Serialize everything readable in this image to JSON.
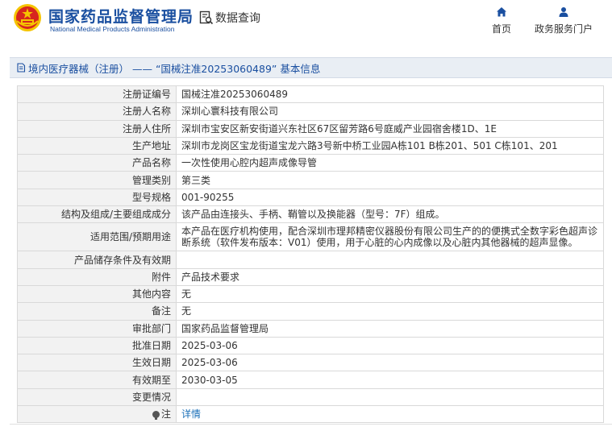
{
  "header": {
    "org_name_cn": "国家药品监督管理局",
    "org_name_en": "National Medical Products Administration",
    "query_label": "数据查询",
    "nav": [
      {
        "label": "首页",
        "icon": "home-icon"
      },
      {
        "label": "政务服务门户",
        "icon": "user-icon"
      }
    ]
  },
  "title_bar": {
    "text": "境内医疗器械（注册） —— “国械注准20253060489” 基本信息"
  },
  "colors": {
    "brand_blue": "#1a4fa0",
    "link_blue": "#1a6fb8",
    "emblem_red": "#d7261e",
    "emblem_gold": "#f5c400"
  },
  "info_rows": [
    {
      "label": "注册证编号",
      "value": "国械注准20253060489"
    },
    {
      "label": "注册人名称",
      "value": "深圳心寰科技有限公司"
    },
    {
      "label": "注册人住所",
      "value": "深圳市宝安区新安街道兴东社区67区留芳路6号庭威产业园宿舍楼1D、1E"
    },
    {
      "label": "生产地址",
      "value": "深圳市龙岗区宝龙街道宝龙六路3号新中桥工业园A栋101 B栋201、501 C栋101、201"
    },
    {
      "label": "产品名称",
      "value": "一次性使用心腔内超声成像导管"
    },
    {
      "label": "管理类别",
      "value": "第三类"
    },
    {
      "label": "型号规格",
      "value": "001-90255"
    },
    {
      "label": "结构及组成/主要组成成分",
      "value": "该产品由连接头、手柄、鞘管以及换能器（型号：7F）组成。"
    },
    {
      "label": "适用范围/预期用途",
      "value": "本产品在医疗机构使用，配合深圳市理邦精密仪器股份有限公司生产的的便携式全数字彩色超声诊断系统（软件发布版本：V01）使用，用于心脏的心内成像以及心脏内其他器械的超声显像。"
    },
    {
      "label": "产品储存条件及有效期",
      "value": ""
    },
    {
      "label": "附件",
      "value": "产品技术要求"
    },
    {
      "label": "其他内容",
      "value": "无"
    },
    {
      "label": "备注",
      "value": "无"
    },
    {
      "label": "审批部门",
      "value": "国家药品监督管理局"
    },
    {
      "label": "批准日期",
      "value": "2025-03-06"
    },
    {
      "label": "生效日期",
      "value": "2025-03-06"
    },
    {
      "label": "有效期至",
      "value": "2030-03-05"
    },
    {
      "label": "变更情况",
      "value": ""
    }
  ],
  "note_row": {
    "label": "注",
    "link_text": "详情"
  }
}
